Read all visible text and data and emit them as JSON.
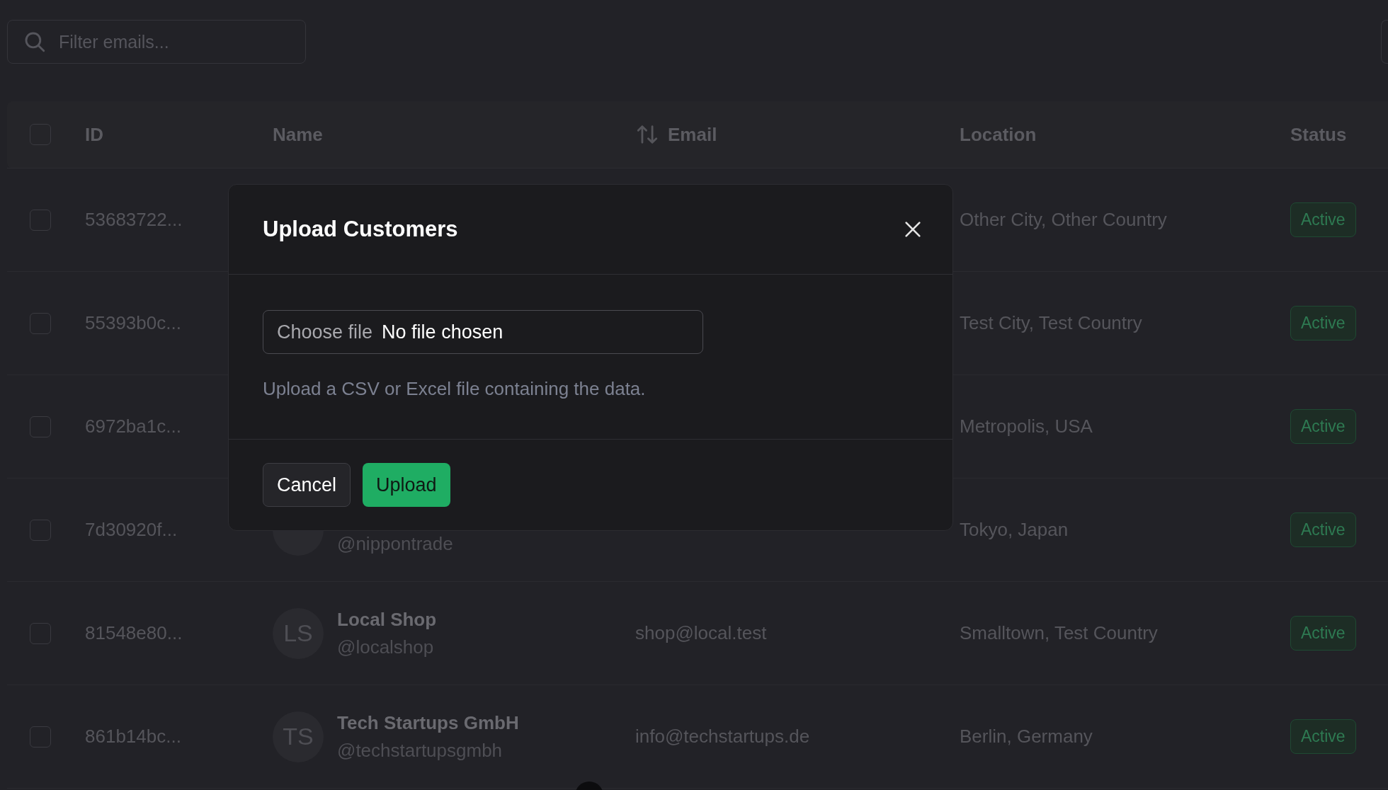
{
  "search": {
    "placeholder": "Filter emails..."
  },
  "table": {
    "header_checked": false,
    "columns": [
      {
        "label": "ID",
        "kind": "plain"
      },
      {
        "label": "Name",
        "kind": "plain"
      },
      {
        "label": "Email",
        "kind": "sortable"
      },
      {
        "label": "Location",
        "kind": "plain"
      },
      {
        "label": "Status",
        "kind": "plain"
      }
    ],
    "rows": [
      {
        "checked": false,
        "id": "53683722...",
        "location": "Other City, Other Country",
        "status": "Active"
      },
      {
        "checked": false,
        "id": "55393b0c...",
        "location": "Test City, Test Country",
        "status": "Active"
      },
      {
        "checked": false,
        "id": "6972ba1c...",
        "location": "Metropolis, USA",
        "status": "Active"
      },
      {
        "checked": false,
        "id": "7d30920f...",
        "handle": "@nippontrade",
        "location": "Tokyo, Japan",
        "status": "Active"
      },
      {
        "checked": false,
        "id": "81548e80...",
        "initials": "LS",
        "name": "Local Shop",
        "handle": "@localshop",
        "email": "shop@local.test",
        "location": "Smalltown, Test Country",
        "status": "Active"
      },
      {
        "checked": false,
        "id": "861b14bc...",
        "initials": "TS",
        "name": "Tech Startups GmbH",
        "handle": "@techstartupsgmbh",
        "email": "info@techstartups.de",
        "location": "Berlin, Germany",
        "status": "Active"
      }
    ]
  },
  "modal": {
    "title": "Upload Customers",
    "file_button": "Choose file",
    "file_status": "No file chosen",
    "help": "Upload a CSV or Excel file containing the data.",
    "buttons": [
      {
        "label": "Cancel",
        "kind": "secondary"
      },
      {
        "label": "Upload",
        "kind": "primary"
      }
    ]
  }
}
